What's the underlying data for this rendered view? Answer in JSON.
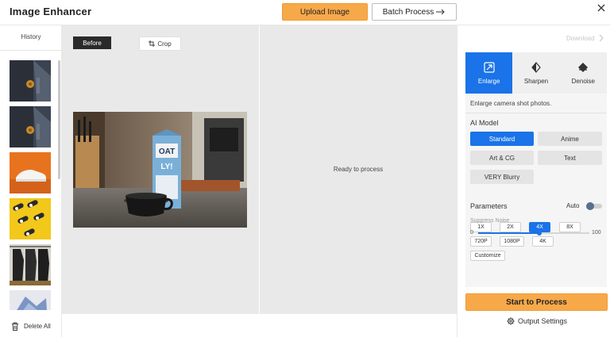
{
  "app": {
    "title": "Image Enhancer"
  },
  "header": {
    "upload_label": "Upload Image",
    "batch_label": "Batch Process",
    "batch_icon": "arrow-right-icon",
    "close_icon": "close-icon"
  },
  "sidebar": {
    "history_label": "History",
    "thumbnails": [
      {
        "name": "history-thumb-1",
        "subject": "denim jacket with buttons"
      },
      {
        "name": "history-thumb-2",
        "subject": "denim jacket with buttons"
      },
      {
        "name": "history-thumb-3",
        "subject": "white sneaker on orange"
      },
      {
        "name": "history-thumb-4",
        "subject": "yellow pills"
      },
      {
        "name": "history-thumb-5",
        "subject": "black clothing on rack"
      },
      {
        "name": "history-thumb-6",
        "subject": "blue item"
      }
    ],
    "delete_label": "Delete All"
  },
  "canvas": {
    "before_label": "Before",
    "crop_label": "Crop",
    "ready_text": "Ready to process"
  },
  "panel": {
    "download_label": "Download",
    "modes": [
      {
        "label": "Enlarge",
        "icon": "enlarge-icon",
        "active": true
      },
      {
        "label": "Sharpen",
        "icon": "sharpen-icon",
        "active": false
      },
      {
        "label": "Denoise",
        "icon": "denoise-icon",
        "active": false
      }
    ],
    "mode_description": "Enlarge camera shot photos.",
    "ai_model_label": "AI Model",
    "models": [
      {
        "label": "Standard",
        "active": true
      },
      {
        "label": "Anime",
        "active": false
      },
      {
        "label": "Art & CG",
        "active": false
      },
      {
        "label": "Text",
        "active": false
      },
      {
        "label": "VERY Blurry",
        "active": false
      }
    ],
    "scales": [
      {
        "label": "1X",
        "active": false
      },
      {
        "label": "2X",
        "active": false
      },
      {
        "label": "4X",
        "active": true
      },
      {
        "label": "8X",
        "active": false
      },
      {
        "label": "720P",
        "active": false
      },
      {
        "label": "1080P",
        "active": false
      },
      {
        "label": "4K",
        "active": false
      },
      {
        "label": "Customize",
        "active": false
      }
    ],
    "parameters_label": "Parameters",
    "auto_label": "Auto",
    "auto_enabled": false,
    "suppress_noise_label": "Suppress Noise",
    "slider_min": "0",
    "slider_max": "100",
    "slider_value": 55,
    "start_label": "Start to Process",
    "output_settings_label": "Output Settings"
  },
  "colors": {
    "accent": "#1a73e8",
    "primary_orange": "#f7a94a"
  }
}
